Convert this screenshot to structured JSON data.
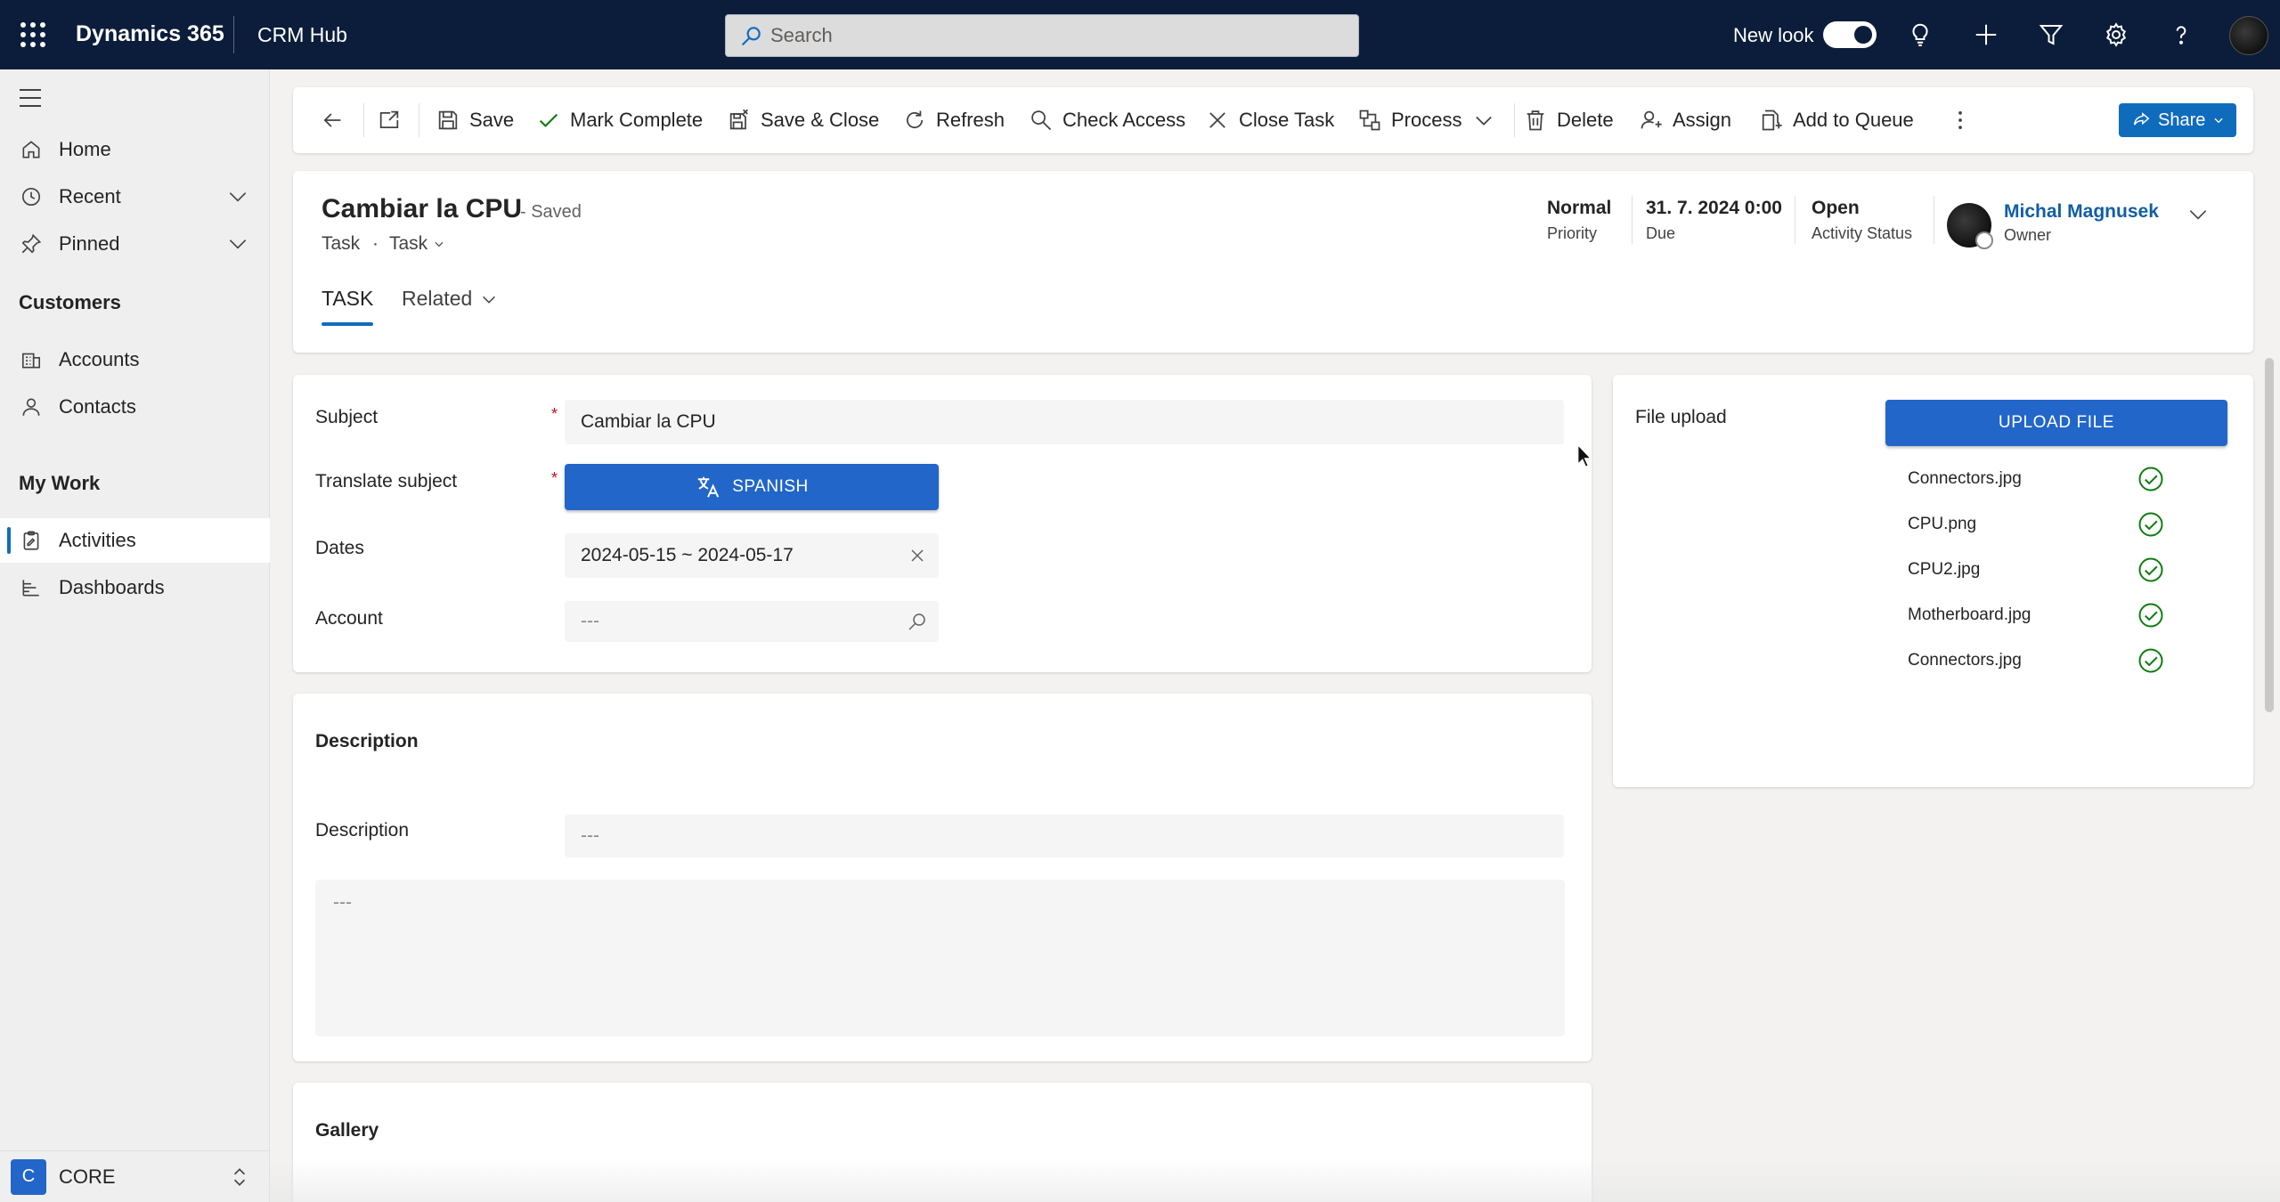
{
  "topbar": {
    "brand": "Dynamics 365",
    "app_name": "CRM Hub",
    "search_placeholder": "Search",
    "new_look_label": "New look",
    "new_look_on": true
  },
  "nav": {
    "items": [
      {
        "label": "Home",
        "icon": "home-icon"
      },
      {
        "label": "Recent",
        "icon": "clock-icon"
      },
      {
        "label": "Pinned",
        "icon": "pin-icon"
      }
    ],
    "groups": [
      {
        "title": "Customers",
        "items": [
          {
            "label": "Accounts",
            "icon": "accounts-icon"
          },
          {
            "label": "Contacts",
            "icon": "person-icon"
          }
        ]
      },
      {
        "title": "My Work",
        "items": [
          {
            "label": "Activities",
            "icon": "clipboard-icon",
            "active": true
          },
          {
            "label": "Dashboards",
            "icon": "dashboard-icon"
          }
        ]
      }
    ],
    "area": {
      "badge": "C",
      "label": "CORE"
    }
  },
  "commands": {
    "save": "Save",
    "mark_complete": "Mark Complete",
    "save_close": "Save & Close",
    "refresh": "Refresh",
    "check_access": "Check Access",
    "close_task": "Close Task",
    "process": "Process",
    "delete": "Delete",
    "assign": "Assign",
    "add_to_queue": "Add to Queue",
    "share": "Share"
  },
  "header": {
    "title": "Cambiar la CPU",
    "saved_status": "- Saved",
    "entity": "Task",
    "separator": "·",
    "form": "Task",
    "fields": [
      {
        "value": "Normal",
        "label": "Priority"
      },
      {
        "value": "31. 7. 2024 0:00",
        "label": "Due"
      },
      {
        "value": "Open",
        "label": "Activity Status"
      }
    ],
    "owner": {
      "name": "Michal Magnusek",
      "label": "Owner"
    },
    "tabs": {
      "task": "TASK",
      "related": "Related"
    }
  },
  "form": {
    "subject_label": "Subject",
    "subject_value": "Cambiar la CPU",
    "translate_label": "Translate subject",
    "translate_button": "SPANISH",
    "dates_label": "Dates",
    "dates_value": "2024-05-15 ~ 2024-05-17",
    "account_label": "Account",
    "account_placeholder": "---",
    "required_mark": "*"
  },
  "upload": {
    "label": "File upload",
    "button": "UPLOAD FILE",
    "files": [
      {
        "name": "Connectors.jpg",
        "status": "uploaded"
      },
      {
        "name": "CPU.png",
        "status": "uploaded"
      },
      {
        "name": "CPU2.jpg",
        "status": "uploaded"
      },
      {
        "name": "Motherboard.jpg",
        "status": "uploaded"
      },
      {
        "name": "Connectors.jpg",
        "status": "uploaded"
      }
    ]
  },
  "description": {
    "section_title": "Description",
    "field_label": "Description",
    "field_placeholder": "---",
    "textarea_placeholder": "---"
  },
  "gallery": {
    "section_title": "Gallery"
  },
  "colors": {
    "topbar_bg": "#0b1d3a",
    "accent": "#0f6cbd",
    "button_blue": "#2266c9",
    "success_green": "#107c10",
    "required_red": "#c50f1f"
  }
}
